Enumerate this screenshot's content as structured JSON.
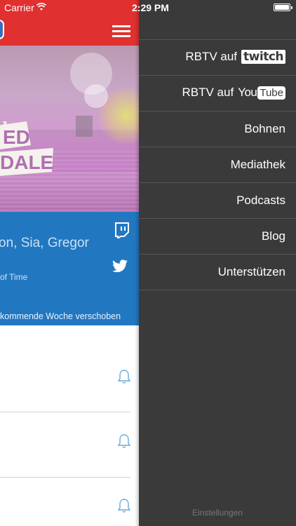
{
  "status_bar": {
    "carrier": "Carrier",
    "time": "2:29 PM"
  },
  "content": {
    "info_title": "on, Sia, Gregor",
    "info_subtitle": "of Time",
    "info_note": "kommende Woche verschoben",
    "banner_text_top": "ED",
    "banner_text_bottom": "DALE"
  },
  "menu": {
    "items": [
      {
        "label": "RBTV auf",
        "brand": "twitch"
      },
      {
        "label": "RBTV auf",
        "brand_you": "You",
        "brand_tube": "Tube"
      },
      {
        "label": "Bohnen"
      },
      {
        "label": "Mediathek"
      },
      {
        "label": "Podcasts"
      },
      {
        "label": "Blog"
      },
      {
        "label": "Unterstützen"
      }
    ],
    "settings_label": "Einstellungen"
  },
  "colors": {
    "header_red": "#e03030",
    "info_blue": "#2278c0",
    "menu_bg": "#3a3a3a",
    "bell_blue": "#6aa8d8"
  },
  "icons": [
    "wifi-icon",
    "battery-icon",
    "hamburger-menu-icon",
    "twitch-icon",
    "twitter-icon",
    "bell-icon"
  ]
}
